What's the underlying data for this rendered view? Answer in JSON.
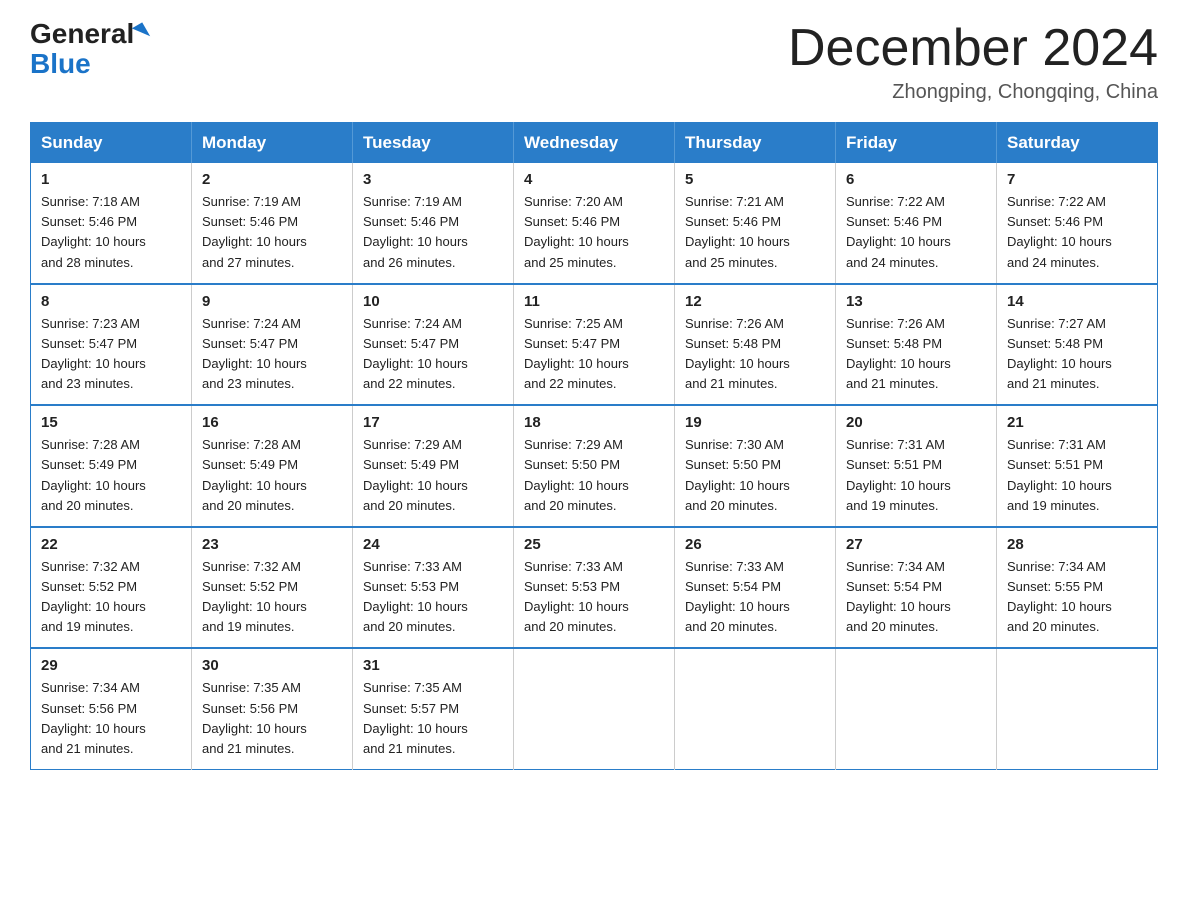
{
  "logo": {
    "text1": "General",
    "text2": "Blue"
  },
  "header": {
    "month_year": "December 2024",
    "location": "Zhongping, Chongqing, China"
  },
  "days_of_week": [
    "Sunday",
    "Monday",
    "Tuesday",
    "Wednesday",
    "Thursday",
    "Friday",
    "Saturday"
  ],
  "weeks": [
    [
      {
        "day": "1",
        "sunrise": "7:18 AM",
        "sunset": "5:46 PM",
        "daylight": "10 hours and 28 minutes."
      },
      {
        "day": "2",
        "sunrise": "7:19 AM",
        "sunset": "5:46 PM",
        "daylight": "10 hours and 27 minutes."
      },
      {
        "day": "3",
        "sunrise": "7:19 AM",
        "sunset": "5:46 PM",
        "daylight": "10 hours and 26 minutes."
      },
      {
        "day": "4",
        "sunrise": "7:20 AM",
        "sunset": "5:46 PM",
        "daylight": "10 hours and 25 minutes."
      },
      {
        "day": "5",
        "sunrise": "7:21 AM",
        "sunset": "5:46 PM",
        "daylight": "10 hours and 25 minutes."
      },
      {
        "day": "6",
        "sunrise": "7:22 AM",
        "sunset": "5:46 PM",
        "daylight": "10 hours and 24 minutes."
      },
      {
        "day": "7",
        "sunrise": "7:22 AM",
        "sunset": "5:46 PM",
        "daylight": "10 hours and 24 minutes."
      }
    ],
    [
      {
        "day": "8",
        "sunrise": "7:23 AM",
        "sunset": "5:47 PM",
        "daylight": "10 hours and 23 minutes."
      },
      {
        "day": "9",
        "sunrise": "7:24 AM",
        "sunset": "5:47 PM",
        "daylight": "10 hours and 23 minutes."
      },
      {
        "day": "10",
        "sunrise": "7:24 AM",
        "sunset": "5:47 PM",
        "daylight": "10 hours and 22 minutes."
      },
      {
        "day": "11",
        "sunrise": "7:25 AM",
        "sunset": "5:47 PM",
        "daylight": "10 hours and 22 minutes."
      },
      {
        "day": "12",
        "sunrise": "7:26 AM",
        "sunset": "5:48 PM",
        "daylight": "10 hours and 21 minutes."
      },
      {
        "day": "13",
        "sunrise": "7:26 AM",
        "sunset": "5:48 PM",
        "daylight": "10 hours and 21 minutes."
      },
      {
        "day": "14",
        "sunrise": "7:27 AM",
        "sunset": "5:48 PM",
        "daylight": "10 hours and 21 minutes."
      }
    ],
    [
      {
        "day": "15",
        "sunrise": "7:28 AM",
        "sunset": "5:49 PM",
        "daylight": "10 hours and 20 minutes."
      },
      {
        "day": "16",
        "sunrise": "7:28 AM",
        "sunset": "5:49 PM",
        "daylight": "10 hours and 20 minutes."
      },
      {
        "day": "17",
        "sunrise": "7:29 AM",
        "sunset": "5:49 PM",
        "daylight": "10 hours and 20 minutes."
      },
      {
        "day": "18",
        "sunrise": "7:29 AM",
        "sunset": "5:50 PM",
        "daylight": "10 hours and 20 minutes."
      },
      {
        "day": "19",
        "sunrise": "7:30 AM",
        "sunset": "5:50 PM",
        "daylight": "10 hours and 20 minutes."
      },
      {
        "day": "20",
        "sunrise": "7:31 AM",
        "sunset": "5:51 PM",
        "daylight": "10 hours and 19 minutes."
      },
      {
        "day": "21",
        "sunrise": "7:31 AM",
        "sunset": "5:51 PM",
        "daylight": "10 hours and 19 minutes."
      }
    ],
    [
      {
        "day": "22",
        "sunrise": "7:32 AM",
        "sunset": "5:52 PM",
        "daylight": "10 hours and 19 minutes."
      },
      {
        "day": "23",
        "sunrise": "7:32 AM",
        "sunset": "5:52 PM",
        "daylight": "10 hours and 19 minutes."
      },
      {
        "day": "24",
        "sunrise": "7:33 AM",
        "sunset": "5:53 PM",
        "daylight": "10 hours and 20 minutes."
      },
      {
        "day": "25",
        "sunrise": "7:33 AM",
        "sunset": "5:53 PM",
        "daylight": "10 hours and 20 minutes."
      },
      {
        "day": "26",
        "sunrise": "7:33 AM",
        "sunset": "5:54 PM",
        "daylight": "10 hours and 20 minutes."
      },
      {
        "day": "27",
        "sunrise": "7:34 AM",
        "sunset": "5:54 PM",
        "daylight": "10 hours and 20 minutes."
      },
      {
        "day": "28",
        "sunrise": "7:34 AM",
        "sunset": "5:55 PM",
        "daylight": "10 hours and 20 minutes."
      }
    ],
    [
      {
        "day": "29",
        "sunrise": "7:34 AM",
        "sunset": "5:56 PM",
        "daylight": "10 hours and 21 minutes."
      },
      {
        "day": "30",
        "sunrise": "7:35 AM",
        "sunset": "5:56 PM",
        "daylight": "10 hours and 21 minutes."
      },
      {
        "day": "31",
        "sunrise": "7:35 AM",
        "sunset": "5:57 PM",
        "daylight": "10 hours and 21 minutes."
      },
      null,
      null,
      null,
      null
    ]
  ]
}
